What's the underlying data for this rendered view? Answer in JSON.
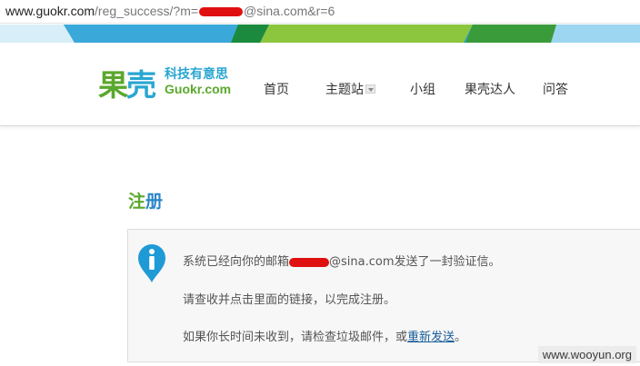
{
  "browser": {
    "url_host": "www.guokr.com",
    "url_path_1": "/reg_success/?m=",
    "url_path_2": "@sina.com&r=6"
  },
  "header": {
    "logo_cn_1": "果",
    "logo_cn_2": "壳",
    "logo_sub": "科技有意思",
    "logo_en": "Guokr.com"
  },
  "nav": {
    "items": [
      "首页",
      "主题站",
      "小组",
      "果壳达人",
      "问答"
    ]
  },
  "page": {
    "title_1": "注",
    "title_2": "册"
  },
  "notice": {
    "line1_pre": "系统已经向你的邮箱",
    "line1_post": "@sina.com发送了一封验证信。",
    "line2": "请查收并点击里面的链接，以完成注册。",
    "line3_pre": "如果你长时间未收到，请检查垃圾邮件，或",
    "resend_link": "重新发送",
    "line3_post": "。"
  },
  "watermark": "www.wooyun.org",
  "colors": {
    "brand_green": "#5aa82c",
    "brand_blue": "#2aa6d2",
    "redaction": "#e01010"
  }
}
